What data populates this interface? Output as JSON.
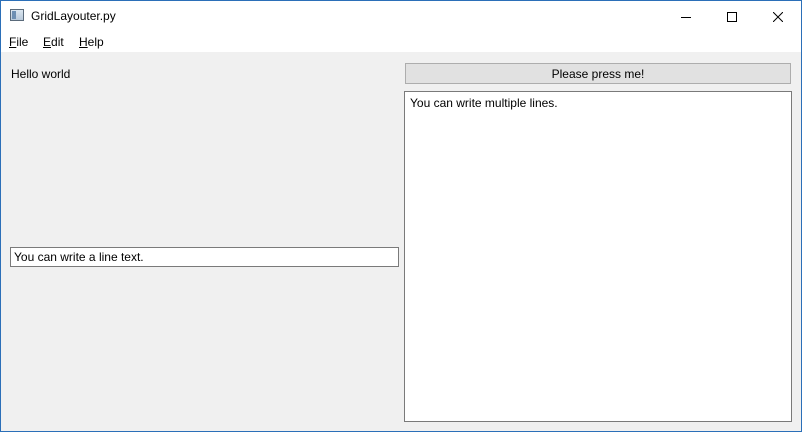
{
  "window": {
    "title": "GridLayouter.py",
    "icon": "python-window-icon"
  },
  "controls": {
    "minimize_icon": "minimize-icon",
    "maximize_icon": "maximize-icon",
    "close_icon": "close-icon"
  },
  "menu": {
    "items": [
      {
        "mnemonic": "F",
        "rest": "ile"
      },
      {
        "mnemonic": "E",
        "rest": "dit"
      },
      {
        "mnemonic": "H",
        "rest": "elp"
      }
    ]
  },
  "content": {
    "label_text": "Hello world",
    "button_label": "Please press me!",
    "line_edit_value": "You can write a line text.",
    "text_edit_value": "You can write multiple lines."
  },
  "colors": {
    "window_border": "#2b6fb8",
    "background": "#f0f0f0",
    "button_face": "#e1e1e1"
  }
}
